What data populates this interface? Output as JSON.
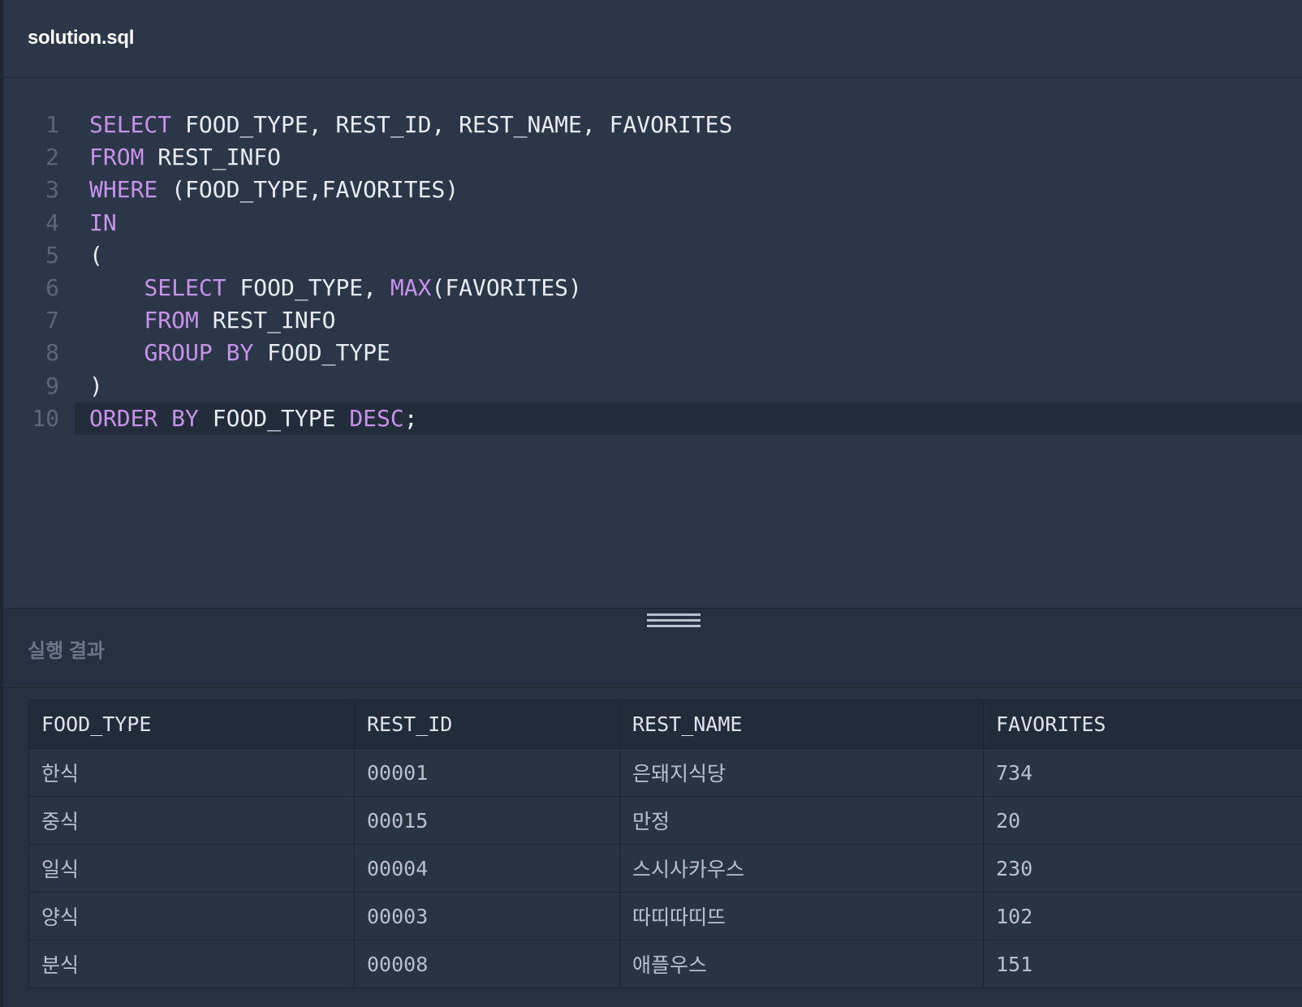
{
  "editor": {
    "filename": "solution.sql",
    "active_line": 10,
    "lines": [
      {
        "n": "1",
        "tokens": [
          {
            "t": "SELECT",
            "k": "kw"
          },
          {
            "t": " FOOD_TYPE, REST_ID, REST_NAME, FAVORITES",
            "k": "id"
          }
        ]
      },
      {
        "n": "2",
        "tokens": [
          {
            "t": "FROM",
            "k": "kw"
          },
          {
            "t": " REST_INFO",
            "k": "id"
          }
        ]
      },
      {
        "n": "3",
        "tokens": [
          {
            "t": "WHERE",
            "k": "kw"
          },
          {
            "t": " (FOOD_TYPE,FAVORITES)",
            "k": "id"
          }
        ]
      },
      {
        "n": "4",
        "tokens": [
          {
            "t": "IN",
            "k": "kw"
          }
        ]
      },
      {
        "n": "5",
        "tokens": [
          {
            "t": "(",
            "k": "id"
          }
        ]
      },
      {
        "n": "6",
        "tokens": [
          {
            "t": "    ",
            "k": "id"
          },
          {
            "t": "SELECT",
            "k": "kw"
          },
          {
            "t": " FOOD_TYPE, ",
            "k": "id"
          },
          {
            "t": "MAX",
            "k": "fn"
          },
          {
            "t": "(FAVORITES)",
            "k": "id"
          }
        ]
      },
      {
        "n": "7",
        "tokens": [
          {
            "t": "    ",
            "k": "id"
          },
          {
            "t": "FROM",
            "k": "kw"
          },
          {
            "t": " REST_INFO",
            "k": "id"
          }
        ]
      },
      {
        "n": "8",
        "tokens": [
          {
            "t": "    ",
            "k": "id"
          },
          {
            "t": "GROUP",
            "k": "kw"
          },
          {
            "t": " ",
            "k": "id"
          },
          {
            "t": "BY",
            "k": "kw"
          },
          {
            "t": " FOOD_TYPE",
            "k": "id"
          }
        ]
      },
      {
        "n": "9",
        "tokens": [
          {
            "t": ")",
            "k": "id"
          }
        ]
      },
      {
        "n": "10",
        "tokens": [
          {
            "t": "ORDER",
            "k": "kw"
          },
          {
            "t": " ",
            "k": "id"
          },
          {
            "t": "BY",
            "k": "kw"
          },
          {
            "t": " FOOD_TYPE ",
            "k": "id"
          },
          {
            "t": "DESC",
            "k": "kw"
          },
          {
            "t": ";",
            "k": "id"
          }
        ]
      }
    ]
  },
  "splitter": {
    "icon": "drag-handle-icon"
  },
  "results": {
    "title": "실행 결과",
    "columns": [
      "FOOD_TYPE",
      "REST_ID",
      "REST_NAME",
      "FAVORITES"
    ],
    "rows": [
      [
        "한식",
        "00001",
        "은돼지식당",
        "734"
      ],
      [
        "중식",
        "00015",
        "만정",
        "20"
      ],
      [
        "일식",
        "00004",
        "스시사카우스",
        "230"
      ],
      [
        "양식",
        "00003",
        "따띠따띠뜨",
        "102"
      ],
      [
        "분식",
        "00008",
        "애플우스",
        "151"
      ]
    ]
  },
  "colors": {
    "keyword": "#c792ea",
    "identifier": "#e8ecf2",
    "line_number": "#5b6779",
    "editor_bg": "#2b3648",
    "result_bg": "#263040"
  }
}
